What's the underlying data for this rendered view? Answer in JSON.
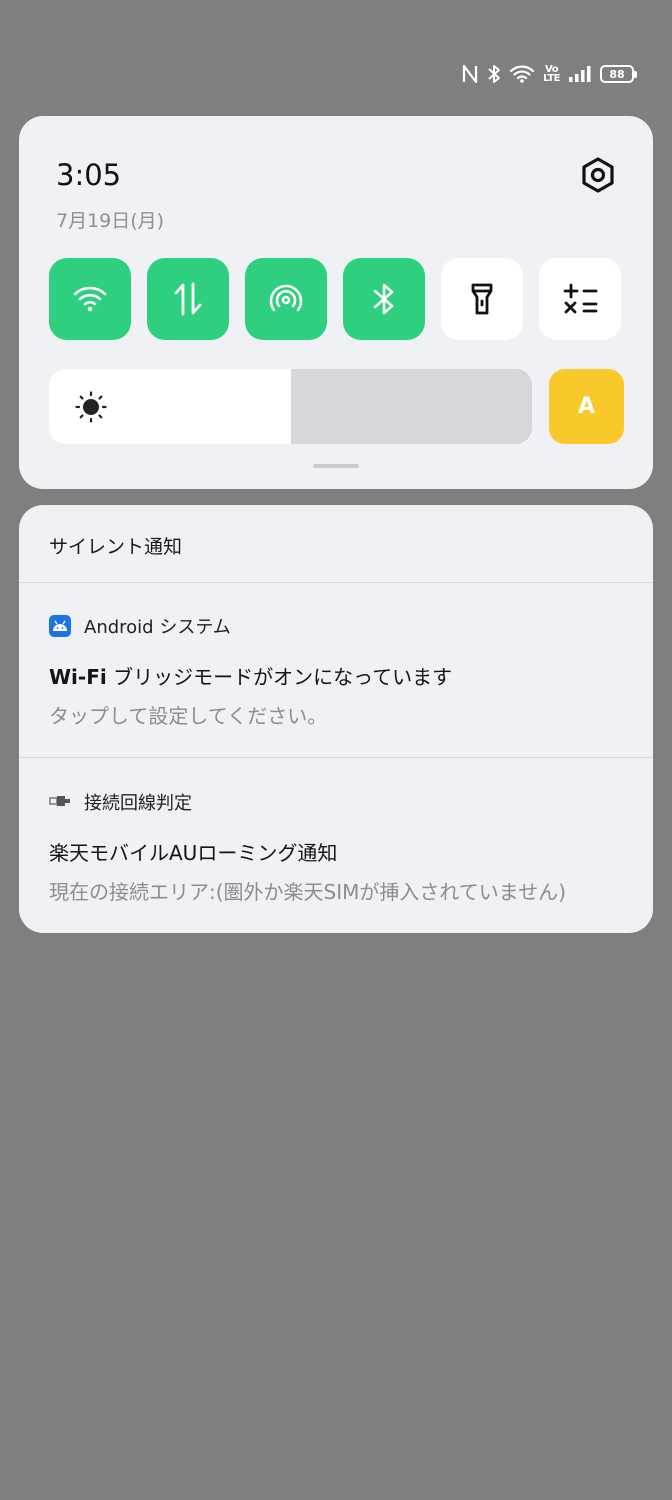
{
  "status_bar": {
    "icons": [
      "nfc-icon",
      "bluetooth-icon",
      "wifi-icon",
      "volte-icon",
      "signal-icon"
    ],
    "volte_label_top": "Vo",
    "volte_label_bottom": "LTE",
    "battery_level": "88"
  },
  "quick_settings": {
    "time": "3:05",
    "date": "7月19日(月)",
    "tiles": [
      {
        "name": "wifi",
        "icon": "wifi-icon",
        "state": "on"
      },
      {
        "name": "mobile-data",
        "icon": "data-arrows-icon",
        "state": "on"
      },
      {
        "name": "hotspot",
        "icon": "hotspot-icon",
        "state": "on"
      },
      {
        "name": "bluetooth",
        "icon": "bluetooth-icon",
        "state": "on"
      },
      {
        "name": "flashlight",
        "icon": "flashlight-icon",
        "state": "off"
      },
      {
        "name": "calculator",
        "icon": "calculator-icon",
        "state": "off"
      }
    ],
    "brightness_level": 0.5,
    "auto_brightness_label": "A",
    "colors": {
      "tile_on": "#2ecf7e",
      "auto_button": "#f9c82a",
      "panel": "#eff1f5"
    }
  },
  "notifications": {
    "section_title": "サイレント通知",
    "items": [
      {
        "app": "Android システム",
        "title_bold": "Wi-Fi",
        "title_rest": " ブリッジモードがオンになっています",
        "body": "タップして設定してください。"
      },
      {
        "app": "接続回線判定",
        "title": "楽天モバイルAUローミング通知",
        "body": "現在の接続エリア:(圏外か楽天SIMが挿入されていません)"
      }
    ]
  }
}
